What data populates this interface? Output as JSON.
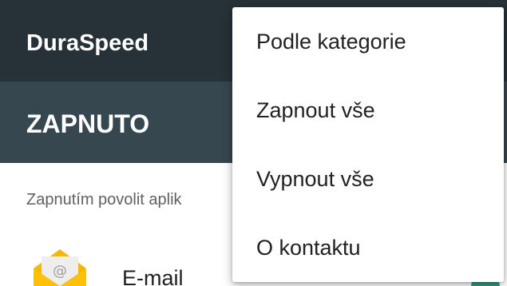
{
  "app_bar": {
    "title": "DuraSpeed"
  },
  "master_switch": {
    "label": "ZAPNUTO",
    "state": "on"
  },
  "description": {
    "text": "Zapnutím povolit aplik"
  },
  "app_list": {
    "items": [
      {
        "name": "E-mail",
        "icon": "email-envelope-icon",
        "enabled": true
      }
    ]
  },
  "overflow_menu": {
    "items": [
      {
        "label": "Podle kategorie"
      },
      {
        "label": "Zapnout vše"
      },
      {
        "label": "Vypnout vše"
      },
      {
        "label": "O kontaktu"
      }
    ]
  },
  "colors": {
    "app_bar": "#263238",
    "switch_bar": "#37474f",
    "menu_background": "#ffffff",
    "toggle_on": "#2e9c80",
    "email_icon": "#f5b800"
  }
}
